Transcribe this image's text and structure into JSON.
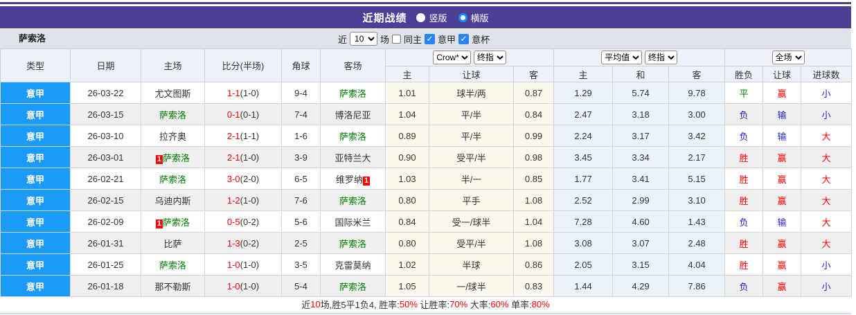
{
  "title_bar": {
    "title": "近期战绩",
    "radio_vertical": "竖版",
    "radio_horizontal": "横版",
    "selected_layout": "横版"
  },
  "toolbar": {
    "team": "萨索洛",
    "recent_label": "近",
    "recent_value": "10",
    "matches_label": "场",
    "checkbox_same_home": {
      "label": "同主",
      "checked": false
    },
    "checkbox_serie_a": {
      "label": "意甲",
      "checked": true
    },
    "checkbox_italy_cup": {
      "label": "意杯",
      "checked": true
    }
  },
  "table": {
    "headers": {
      "type": "类型",
      "date": "日期",
      "home": "主场",
      "score": "比分(半场)",
      "corner": "角球",
      "away": "客场",
      "handicap_group": {
        "select_company": "Crow*",
        "select_time": "终指",
        "home": "主",
        "handicap": "让球",
        "away": "客"
      },
      "average_group": {
        "select_kind": "平均值",
        "select_time": "终指",
        "home": "主",
        "draw": "和",
        "away": "客"
      },
      "result_group": {
        "select_scope": "全场",
        "win_lose": "胜负",
        "handicap_result": "让球",
        "goals": "进球数"
      }
    },
    "rows": [
      {
        "type": "意甲",
        "date": "26-03-22",
        "home": "尤文图斯",
        "home_is_team": false,
        "home_badge": "",
        "away": "萨索洛",
        "away_is_team": true,
        "away_badge": "",
        "score_main": "1-1",
        "score_half": "(1-0)",
        "corner": "9-4",
        "odds_home": "1.01",
        "odds_handicap": "球半/两",
        "odds_away": "0.87",
        "avg_home": "1.29",
        "avg_draw": "5.74",
        "avg_away": "9.78",
        "result": "平",
        "result_color": "green",
        "handicap_result": "赢",
        "handicap_color": "red",
        "goals": "小",
        "goals_color": "blue"
      },
      {
        "type": "意甲",
        "date": "26-03-15",
        "home": "萨索洛",
        "home_is_team": true,
        "home_badge": "",
        "away": "博洛尼亚",
        "away_is_team": false,
        "away_badge": "",
        "score_main": "0-1",
        "score_half": "(0-1)",
        "corner": "7-4",
        "odds_home": "1.04",
        "odds_handicap": "平/半",
        "odds_away": "0.84",
        "avg_home": "2.47",
        "avg_draw": "3.18",
        "avg_away": "3.00",
        "result": "负",
        "result_color": "blue",
        "handicap_result": "输",
        "handicap_color": "blue",
        "goals": "小",
        "goals_color": "blue"
      },
      {
        "type": "意甲",
        "date": "26-03-10",
        "home": "拉齐奥",
        "home_is_team": false,
        "home_badge": "",
        "away": "萨索洛",
        "away_is_team": true,
        "away_badge": "",
        "score_main": "2-1",
        "score_half": "(1-1)",
        "corner": "1-6",
        "odds_home": "0.89",
        "odds_handicap": "平/半",
        "odds_away": "0.99",
        "avg_home": "2.24",
        "avg_draw": "3.17",
        "avg_away": "3.42",
        "result": "负",
        "result_color": "blue",
        "handicap_result": "输",
        "handicap_color": "blue",
        "goals": "大",
        "goals_color": "red"
      },
      {
        "type": "意甲",
        "date": "26-03-01",
        "home": "萨索洛",
        "home_is_team": true,
        "home_badge": "1",
        "away": "亚特兰大",
        "away_is_team": false,
        "away_badge": "",
        "score_main": "2-1",
        "score_half": "(1-0)",
        "corner": "3-9",
        "odds_home": "0.90",
        "odds_handicap": "受平/半",
        "odds_away": "0.98",
        "avg_home": "3.45",
        "avg_draw": "3.34",
        "avg_away": "2.17",
        "result": "胜",
        "result_color": "red",
        "handicap_result": "赢",
        "handicap_color": "red",
        "goals": "大",
        "goals_color": "red"
      },
      {
        "type": "意甲",
        "date": "26-02-21",
        "home": "萨索洛",
        "home_is_team": true,
        "home_badge": "",
        "away": "维罗纳",
        "away_is_team": false,
        "away_badge": "1",
        "score_main": "3-0",
        "score_half": "(2-0)",
        "corner": "6-5",
        "odds_home": "1.03",
        "odds_handicap": "半/一",
        "odds_away": "0.85",
        "avg_home": "1.77",
        "avg_draw": "3.41",
        "avg_away": "5.15",
        "result": "胜",
        "result_color": "red",
        "handicap_result": "赢",
        "handicap_color": "red",
        "goals": "大",
        "goals_color": "red"
      },
      {
        "type": "意甲",
        "date": "26-02-15",
        "home": "乌迪内斯",
        "home_is_team": false,
        "home_badge": "",
        "away": "萨索洛",
        "away_is_team": true,
        "away_badge": "",
        "score_main": "1-2",
        "score_half": "(1-0)",
        "corner": "7-6",
        "odds_home": "0.80",
        "odds_handicap": "平手",
        "odds_away": "1.08",
        "avg_home": "2.52",
        "avg_draw": "2.99",
        "avg_away": "3.10",
        "result": "胜",
        "result_color": "red",
        "handicap_result": "赢",
        "handicap_color": "red",
        "goals": "大",
        "goals_color": "red"
      },
      {
        "type": "意甲",
        "date": "26-02-09",
        "home": "萨索洛",
        "home_is_team": true,
        "home_badge": "1",
        "away": "国际米兰",
        "away_is_team": false,
        "away_badge": "",
        "score_main": "0-5",
        "score_half": "(0-2)",
        "corner": "5-6",
        "odds_home": "0.84",
        "odds_handicap": "受一/球半",
        "odds_away": "1.04",
        "avg_home": "7.28",
        "avg_draw": "4.60",
        "avg_away": "1.43",
        "result": "负",
        "result_color": "blue",
        "handicap_result": "输",
        "handicap_color": "blue",
        "goals": "大",
        "goals_color": "red"
      },
      {
        "type": "意甲",
        "date": "26-01-31",
        "home": "比萨",
        "home_is_team": false,
        "home_badge": "",
        "away": "萨索洛",
        "away_is_team": true,
        "away_badge": "",
        "score_main": "1-3",
        "score_half": "(0-2)",
        "corner": "2-5",
        "odds_home": "0.80",
        "odds_handicap": "受平/半",
        "odds_away": "1.08",
        "avg_home": "3.08",
        "avg_draw": "3.07",
        "avg_away": "2.48",
        "result": "胜",
        "result_color": "red",
        "handicap_result": "赢",
        "handicap_color": "red",
        "goals": "大",
        "goals_color": "red"
      },
      {
        "type": "意甲",
        "date": "26-01-25",
        "home": "萨索洛",
        "home_is_team": true,
        "home_badge": "",
        "away": "克雷莫纳",
        "away_is_team": false,
        "away_badge": "",
        "score_main": "1-0",
        "score_half": "(1-0)",
        "corner": "3-5",
        "odds_home": "1.02",
        "odds_handicap": "半球",
        "odds_away": "0.86",
        "avg_home": "2.05",
        "avg_draw": "3.15",
        "avg_away": "4.04",
        "result": "胜",
        "result_color": "red",
        "handicap_result": "赢",
        "handicap_color": "red",
        "goals": "小",
        "goals_color": "blue"
      },
      {
        "type": "意甲",
        "date": "26-01-18",
        "home": "那不勒斯",
        "home_is_team": false,
        "home_badge": "",
        "away": "萨索洛",
        "away_is_team": true,
        "away_badge": "",
        "score_main": "1-0",
        "score_half": "(1-0)",
        "corner": "5-4",
        "odds_home": "1.05",
        "odds_handicap": "一/球半",
        "odds_away": "0.83",
        "avg_home": "1.44",
        "avg_draw": "4.29",
        "avg_away": "7.86",
        "result": "负",
        "result_color": "blue",
        "handicap_result": "赢",
        "handicap_color": "red",
        "goals": "小",
        "goals_color": "blue"
      }
    ]
  },
  "footer": {
    "segments": [
      {
        "text": "近",
        "red": false
      },
      {
        "text": "10",
        "red": true
      },
      {
        "text": "场,胜5平1负4, 胜率:",
        "red": false
      },
      {
        "text": "50%",
        "red": true
      },
      {
        "text": " 让胜率:",
        "red": false
      },
      {
        "text": "70%",
        "red": true
      },
      {
        "text": " 大率:",
        "red": false
      },
      {
        "text": "60%",
        "red": true
      },
      {
        "text": " 单率:",
        "red": false
      },
      {
        "text": "80%",
        "red": true
      }
    ]
  },
  "colors": {
    "accent_purple": "#4c3f96",
    "league_blue": "#1b9af7",
    "team_green": "#008000",
    "win_red": "#ff0000",
    "lose_blue": "#2222cc",
    "row_alt_gray": "#efefef",
    "handicap_tint": "#fdf8ee",
    "average_tint": "#e9f3f9"
  }
}
